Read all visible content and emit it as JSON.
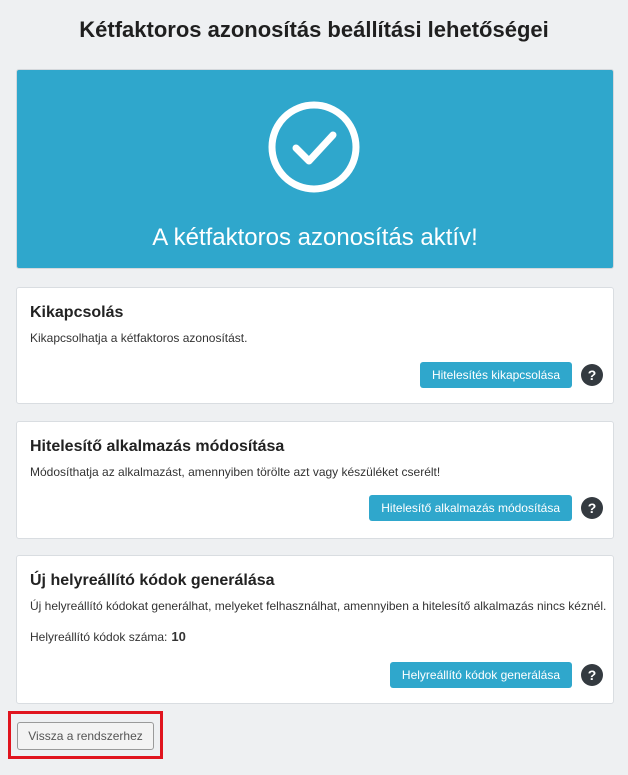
{
  "page": {
    "title": "Kétfaktoros azonosítás beállítási lehetőségei"
  },
  "banner": {
    "status_text": "A kétfaktoros azonosítás aktív!",
    "icon": "check-circle-icon",
    "color": "#2fa7cc"
  },
  "cards": [
    {
      "title": "Kikapcsolás",
      "description": "Kikapcsolhatja a kétfaktoros azonosítást.",
      "button_label": "Hitelesítés kikapcsolása",
      "help_label": "?"
    },
    {
      "title": "Hitelesítő alkalmazás módosítása",
      "description": "Módosíthatja az alkalmazást, amennyiben törölte azt vagy készüléket cserélt!",
      "button_label": "Hitelesítő alkalmazás módosítása",
      "help_label": "?"
    },
    {
      "title": "Új helyreállító kódok generálása",
      "description": "Új helyreállító kódokat generálhat, melyeket felhasználhat, amennyiben a hitelesítő alkalmazás nincs kéznél.",
      "count_label": "Helyreállító kódok száma:",
      "count_value": "10",
      "button_label": "Helyreállító kódok generálása",
      "help_label": "?"
    }
  ],
  "footer": {
    "back_label": "Vissza a rendszerhez"
  },
  "colors": {
    "accent": "#2fa7cc",
    "help": "#343a40",
    "highlight": "#e0141e"
  }
}
